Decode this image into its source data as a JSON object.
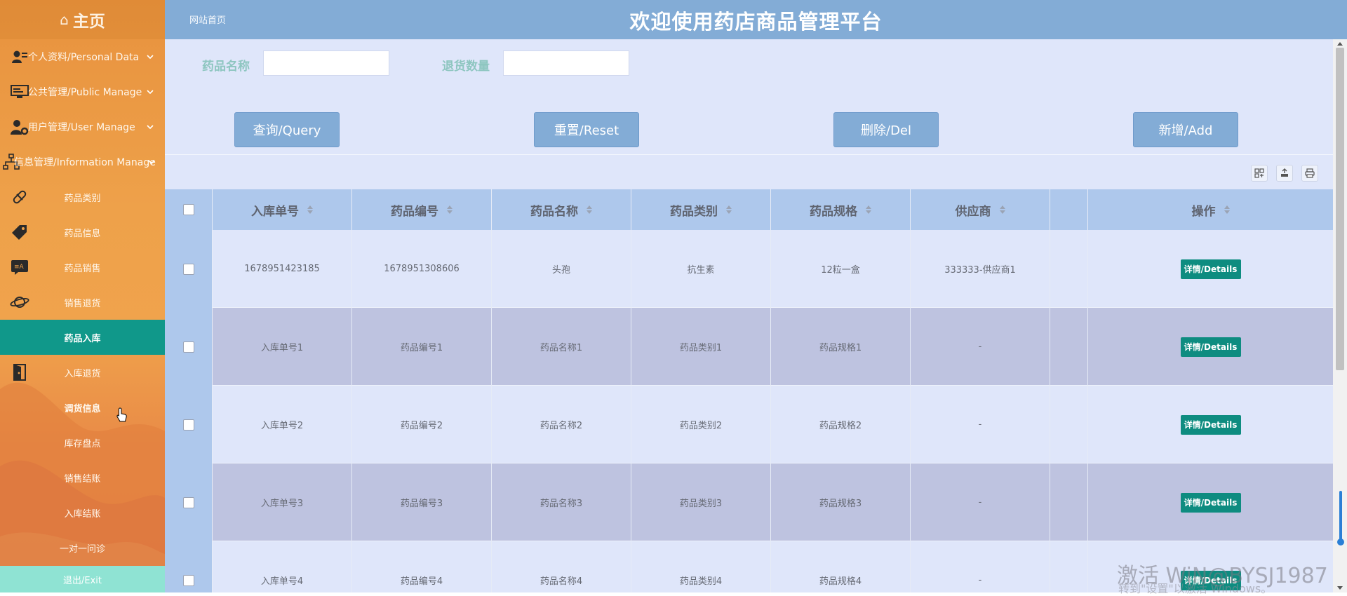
{
  "sidebar": {
    "logo": "主页",
    "menus": [
      {
        "label": "个人资料/Personal Data",
        "icon": "user-card-icon"
      },
      {
        "label": "公共管理/Public Manage",
        "icon": "monitor-icon"
      },
      {
        "label": "用户管理/User Manage",
        "icon": "user-gear-icon"
      },
      {
        "label": "信息管理/Information Manage",
        "icon": "sitemap-icon"
      }
    ],
    "items": [
      {
        "label": "药品类别",
        "icon": "pill-icon"
      },
      {
        "label": "药品信息",
        "icon": "tag-icon"
      },
      {
        "label": "药品销售",
        "icon": "translate-icon"
      },
      {
        "label": "销售退货",
        "icon": "planet-icon"
      },
      {
        "label": "药品入库",
        "active": true
      },
      {
        "label": "入库退货",
        "icon": "door-icon"
      },
      {
        "label": "调货信息"
      },
      {
        "label": "库存盘点"
      },
      {
        "label": "销售结账"
      },
      {
        "label": "入库结账"
      },
      {
        "label": "一对一问诊"
      }
    ],
    "exit": "退出/Exit"
  },
  "header": {
    "breadcrumb": "网站首页",
    "title": "欢迎使用药店商品管理平台"
  },
  "search": {
    "name_label": "药品名称",
    "name_value": "",
    "qty_label": "退货数量",
    "qty_value": ""
  },
  "actions": {
    "query": "查询/Query",
    "reset": "重置/Reset",
    "delete": "删除/Del",
    "add": "新增/Add"
  },
  "table": {
    "columns": [
      "入库单号",
      "药品编号",
      "药品名称",
      "药品类别",
      "药品规格",
      "供应商",
      "",
      "操作"
    ],
    "detail_label": "详情/Details",
    "rows": [
      [
        "1678951423185",
        "1678951308606",
        "头孢",
        "抗生素",
        "12粒一盒",
        "333333-供应商1"
      ],
      [
        "入库单号1",
        "药品编号1",
        "药品名称1",
        "药品类别1",
        "药品规格1",
        "-"
      ],
      [
        "入库单号2",
        "药品编号2",
        "药品名称2",
        "药品类别2",
        "药品规格2",
        "-"
      ],
      [
        "入库单号3",
        "药品编号3",
        "药品名称3",
        "药品类别3",
        "药品规格3",
        "-"
      ],
      [
        "入库单号4",
        "药品编号4",
        "药品名称4",
        "药品类别4",
        "药品规格4",
        "-"
      ]
    ]
  },
  "watermark": {
    "line1": "激活 WiN@BYSJ1987",
    "line2": "转到\"设置\"以激活 Windows。"
  },
  "colors": {
    "sidebar": "#eea14a",
    "active": "#10988a",
    "header": "#83acd6",
    "content_bg": "#dfe6fa",
    "row_alt": "#bec3e0",
    "detail_button": "#0e8c80"
  }
}
